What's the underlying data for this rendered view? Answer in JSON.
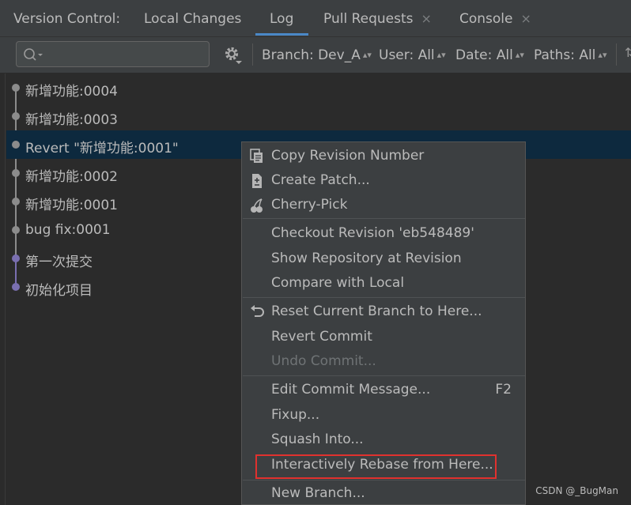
{
  "tabbar": {
    "title": "Version Control:",
    "tabs": [
      {
        "label": "Local Changes",
        "closable": false,
        "active": false
      },
      {
        "label": "Log",
        "closable": false,
        "active": true
      },
      {
        "label": "Pull Requests",
        "closable": true,
        "active": false
      },
      {
        "label": "Console",
        "closable": true,
        "active": false
      }
    ],
    "close_glyph": "×"
  },
  "toolbar": {
    "search": {
      "value": "",
      "placeholder": ""
    },
    "filters": [
      {
        "label": "Branch: Dev_A"
      },
      {
        "label": "User: All"
      },
      {
        "label": "Date: All"
      },
      {
        "label": "Paths: All"
      }
    ],
    "filter_arrows": "▴▾"
  },
  "log": {
    "commits": [
      {
        "message": "新增功能:0004",
        "selected": false,
        "dot_color": "#8c8c8c"
      },
      {
        "message": "新增功能:0003",
        "selected": false,
        "dot_color": "#8c8c8c"
      },
      {
        "message": "Revert \"新增功能:0001\"",
        "selected": true,
        "dot_color": "#8c8c8c"
      },
      {
        "message": "新增功能:0002",
        "selected": false,
        "dot_color": "#8c8c8c"
      },
      {
        "message": "新增功能:0001",
        "selected": false,
        "dot_color": "#8c8c8c"
      },
      {
        "message": "bug fix:0001",
        "selected": false,
        "dot_color": "#8c8c8c"
      },
      {
        "message": "第一次提交",
        "selected": false,
        "dot_color": "#7a6fb0"
      },
      {
        "message": "初始化项目",
        "selected": false,
        "dot_color": "#7a6fb0"
      }
    ]
  },
  "context_menu": {
    "items": [
      {
        "label": "Copy Revision Number",
        "icon": "copy-icon",
        "enabled": true
      },
      {
        "label": "Create Patch...",
        "icon": "patch-icon",
        "enabled": true
      },
      {
        "label": "Cherry-Pick",
        "icon": "cherry-icon",
        "enabled": true
      },
      {
        "label": "Checkout Revision 'eb548489'",
        "enabled": true
      },
      {
        "label": "Show Repository at Revision",
        "enabled": true
      },
      {
        "label": "Compare with Local",
        "enabled": true
      },
      {
        "label": "Reset Current Branch to Here...",
        "icon": "undo-icon",
        "enabled": true
      },
      {
        "label": "Revert Commit",
        "enabled": true
      },
      {
        "label": "Undo Commit...",
        "enabled": false
      },
      {
        "label": "Edit Commit Message...",
        "shortcut": "F2",
        "enabled": true
      },
      {
        "label": "Fixup...",
        "enabled": true
      },
      {
        "label": "Squash Into...",
        "enabled": true
      },
      {
        "label": "Interactively Rebase from Here...",
        "enabled": true,
        "highlighted": true
      },
      {
        "label": "New Branch...",
        "enabled": true
      }
    ]
  },
  "colors": {
    "selection": "#0d293e",
    "accent": "#4a88c7",
    "highlight_border": "#e0312e"
  },
  "watermark": "CSDN @_BugMan"
}
